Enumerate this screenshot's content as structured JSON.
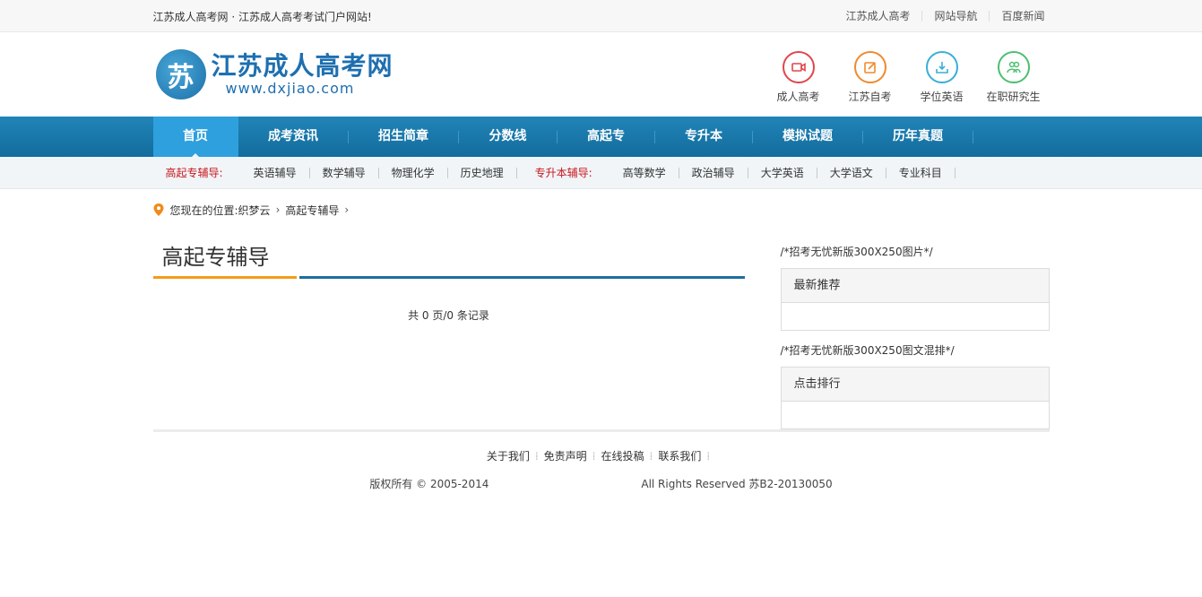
{
  "topbar": {
    "slogan": "江苏成人高考网 · 江苏成人高考考试门户网站!",
    "links": [
      "江苏成人高考",
      "网站导航",
      "百度新闻"
    ]
  },
  "logo": {
    "mark": "苏",
    "title": "江苏成人高考网",
    "url": "www.dxjiao.com"
  },
  "quick": [
    {
      "label": "成人高考",
      "icon": "video-icon",
      "color": "#e0474c"
    },
    {
      "label": "江苏自考",
      "icon": "edit-icon",
      "color": "#f08a2c"
    },
    {
      "label": "学位英语",
      "icon": "download-icon",
      "color": "#3aaed8"
    },
    {
      "label": "在职研究生",
      "icon": "users-icon",
      "color": "#4cbf6f"
    }
  ],
  "nav": [
    "首页",
    "成考资讯",
    "招生简章",
    "分数线",
    "高起专",
    "专升本",
    "模拟试题",
    "历年真题"
  ],
  "subnav": {
    "cat1": "高起专辅导:",
    "items1": [
      "英语辅导",
      "数学辅导",
      "物理化学",
      "历史地理"
    ],
    "cat2": "专升本辅导:",
    "items2": [
      "高等数学",
      "政治辅导",
      "大学英语",
      "大学语文",
      "专业科目"
    ]
  },
  "breadcrumb": {
    "prefix": "您现在的位置:",
    "items": [
      "织梦云",
      "高起专辅导"
    ]
  },
  "main": {
    "title": "高起专辅导",
    "pager": "共 0 页/0 条记录"
  },
  "sidebar": {
    "note1": "/*招考无忧新版300X250图片*/",
    "box1": "最新推荐",
    "note2": "/*招考无忧新版300X250图文混排*/",
    "box2": "点击排行"
  },
  "footer": {
    "links": [
      "关于我们",
      "免责声明",
      "在线投稿",
      "联系我们"
    ],
    "copyright": "版权所有 © 2005-2014",
    "rights": "All Rights Reserved 苏B2-20130050"
  }
}
